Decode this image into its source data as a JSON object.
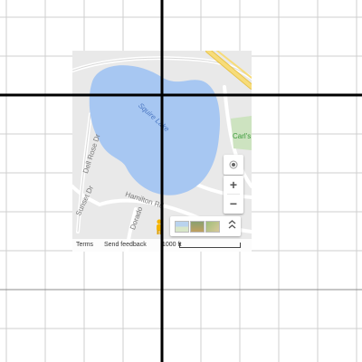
{
  "map": {
    "lake_label": "Squire Lake",
    "park_label": "Carl's",
    "streets": {
      "dell_rose": "Dell Rose Dr",
      "sunset": "Sunset Dr",
      "hamilton": "Hamilton Rd",
      "dorado": "Dorado"
    },
    "controls": {
      "zoom_in": "+",
      "zoom_out": "−",
      "expand": "«"
    },
    "footer": {
      "terms": "Terms",
      "feedback": "Send feedback",
      "scale": "1000 ft"
    },
    "icons": [
      "locate-icon",
      "pegman-icon",
      "map-thumb",
      "satellite-thumb",
      "terrain-thumb",
      "chevron-up-icon"
    ],
    "colors": {
      "water": "#a7c7f2",
      "land": "#e9e9e9",
      "road": "#ffffff",
      "highway": "#f7dc7a",
      "axis": "#000000",
      "grid": "#cccccc"
    }
  }
}
